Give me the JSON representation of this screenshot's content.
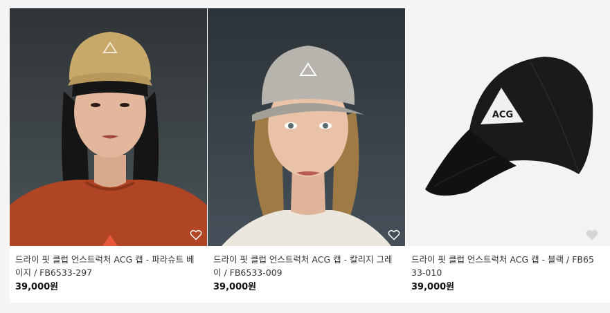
{
  "products": [
    {
      "name": "드라이 핏 클럽 언스트럭처 ACG 캡 - 파라슈트 베이지 / FB6533-297",
      "price": "39,000원",
      "image_icon": "model-wearing-beige-cap-image",
      "cap_color": "#c9a96a",
      "background_color": "#3b4246"
    },
    {
      "name": "드라이 핏 클럽 언스트럭처 ACG 캡 - 칼리지 그레이 / FB6533-009",
      "price": "39,000원",
      "image_icon": "model-wearing-grey-cap-image",
      "cap_color": "#b7b3ad",
      "background_color": "#353c42"
    },
    {
      "name": "드라이 핏 클럽 언스트럭처 ACG 캡 - 블랙 / FB6533-010",
      "price": "39,000원",
      "image_icon": "black-cap-product-image",
      "cap_color": "#161616",
      "background_color": "#f3f3f3"
    }
  ],
  "wishlist_icon": "heart-icon"
}
